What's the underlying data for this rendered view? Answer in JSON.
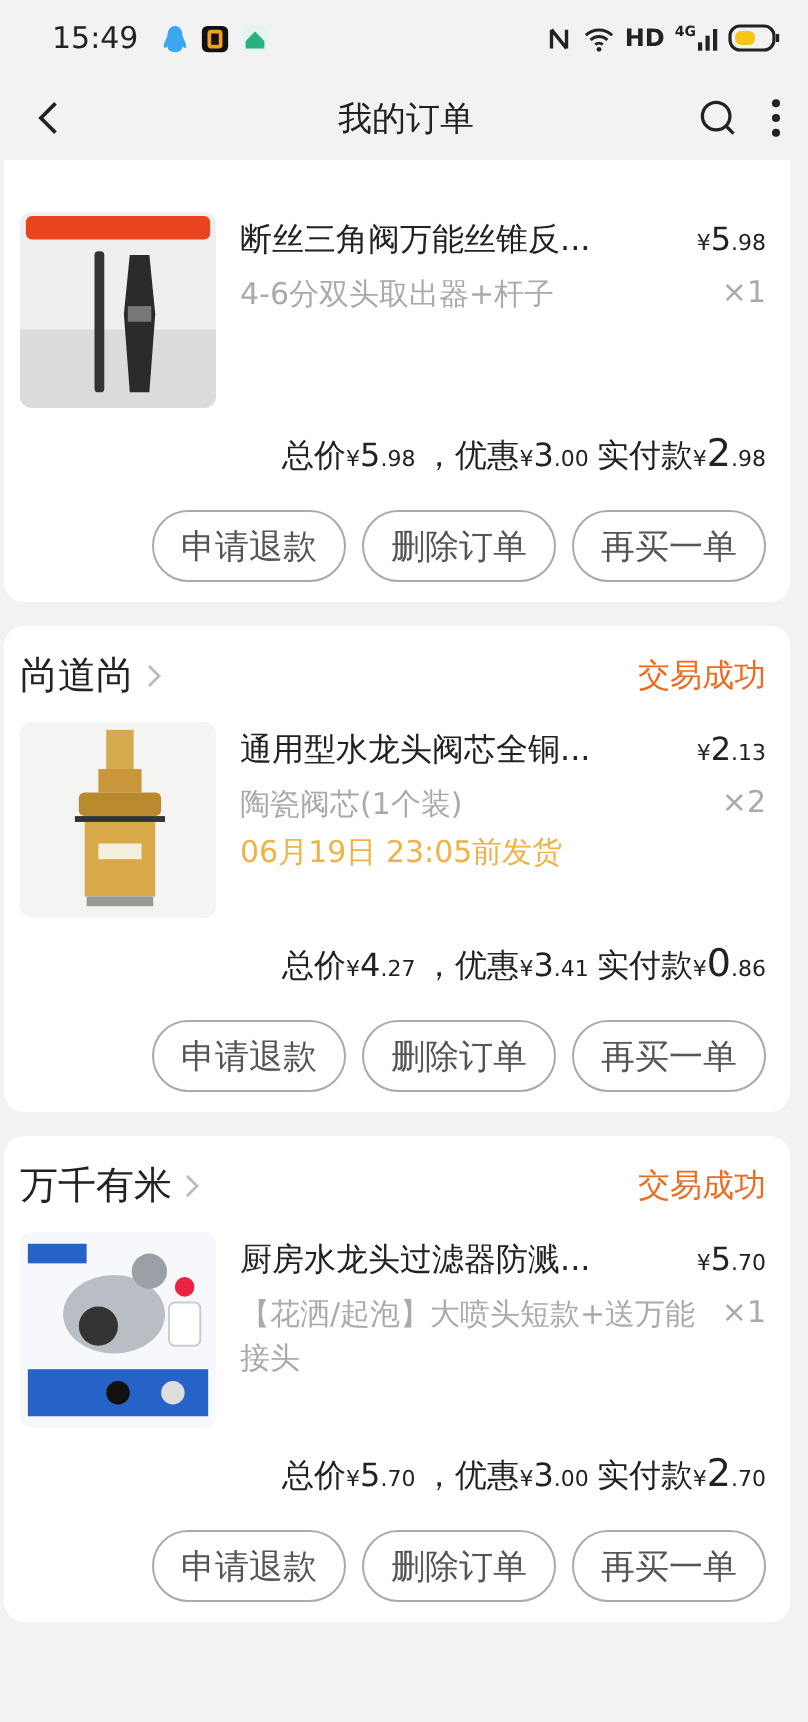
{
  "status_bar": {
    "time": "15:49",
    "hd": "HD",
    "network": "4G"
  },
  "nav": {
    "title": "我的订单"
  },
  "orders": [
    {
      "item": {
        "kind": "picture",
        "title": "断丝三角阀万能丝锥反...",
        "price": "¥5.98",
        "variant": "4-6分双头取出器+杆子",
        "quantity": "×1"
      },
      "summary": [
        "总价",
        "¥5.98",
        "，优惠",
        "¥3.00",
        "实付款",
        "¥2.98"
      ],
      "buttons": [
        "申请退款",
        "删除订单",
        "再买一单"
      ]
    },
    {
      "shop": "尚道尚",
      "status": "交易成功",
      "item": {
        "kind": "picture",
        "title": "通用型水龙头阀芯全铜...",
        "price": "¥2.13",
        "variant": "陶瓷阀芯(1个装)",
        "quantity": "×2",
        "delivery": "06月19日 23:05前发货"
      },
      "summary": [
        "总价",
        "¥4.27",
        "，优惠",
        "¥3.41",
        "实付款",
        "¥0.86"
      ],
      "buttons": [
        "申请退款",
        "删除订单",
        "再买一单"
      ]
    },
    {
      "shop": "万千有米",
      "status": "交易成功",
      "item": {
        "kind": "picture",
        "title": "厨房水龙头过滤器防溅...",
        "price": "¥5.70",
        "variant": "【花洒/起泡】大喷头短款+送万能接头",
        "quantity": "×1"
      },
      "summary": [
        "总价",
        "¥5.70",
        "，优惠",
        "¥3.00",
        "实付款",
        "¥2.70"
      ],
      "buttons": [
        "申请退款",
        "删除订单",
        "再买一单"
      ]
    }
  ]
}
